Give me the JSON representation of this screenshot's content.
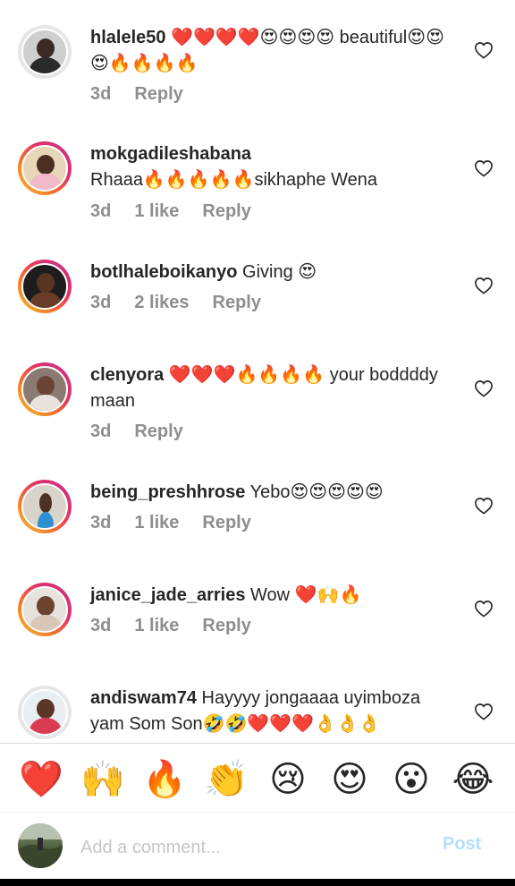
{
  "colors": {
    "meta_gray": "#8e8e8e",
    "post_disabled": "#b2dffc",
    "story_ring": [
      "#f9c02e",
      "#e1306c",
      "#c13584"
    ]
  },
  "comments": [
    {
      "username": "hlalele50",
      "text": " ❤️❤️❤️❤️😍😍😍😍 beautiful😍😍😍🔥🔥🔥🔥",
      "time": "3d",
      "likes": "",
      "reply": "Reply"
    },
    {
      "username": "mokgadileshabana",
      "text": " Rhaaa🔥🔥🔥🔥🔥sikhaphe Wena",
      "time": "3d",
      "likes": "1 like",
      "reply": "Reply"
    },
    {
      "username": "botlhaleboikanyo",
      "text": " Giving 😍",
      "time": "3d",
      "likes": "2 likes",
      "reply": "Reply"
    },
    {
      "username": "clenyora",
      "text": " ❤️❤️❤️🔥🔥🔥🔥 your boddddy maan",
      "time": "3d",
      "likes": "",
      "reply": "Reply"
    },
    {
      "username": "being_preshhrose",
      "text": " Yebo😍😍😍😍😍",
      "time": "3d",
      "likes": "1 like",
      "reply": "Reply"
    },
    {
      "username": "janice_jade_arries",
      "text": " Wow ❤️🙌🔥",
      "time": "3d",
      "likes": "1 like",
      "reply": "Reply"
    },
    {
      "username": "andiswam74",
      "text": " Hayyyy jongaaaa uyimboza yam Som Son🤣🤣❤️❤️❤️👌👌👌",
      "time": "",
      "likes": "",
      "reply": ""
    }
  ],
  "reactions": [
    {
      "emoji": "❤️",
      "name": "heart"
    },
    {
      "emoji": "🙌",
      "name": "raised-hands"
    },
    {
      "emoji": "🔥",
      "name": "fire"
    },
    {
      "emoji": "👏",
      "name": "clapping-hands"
    },
    {
      "emoji": "😢",
      "name": "crying-face"
    },
    {
      "emoji": "😍",
      "name": "heart-eyes"
    },
    {
      "emoji": "😮",
      "name": "surprised-face"
    },
    {
      "emoji": "😂",
      "name": "tears-of-joy"
    }
  ],
  "compose": {
    "placeholder": "Add a comment...",
    "value": "",
    "post_label": "Post"
  }
}
